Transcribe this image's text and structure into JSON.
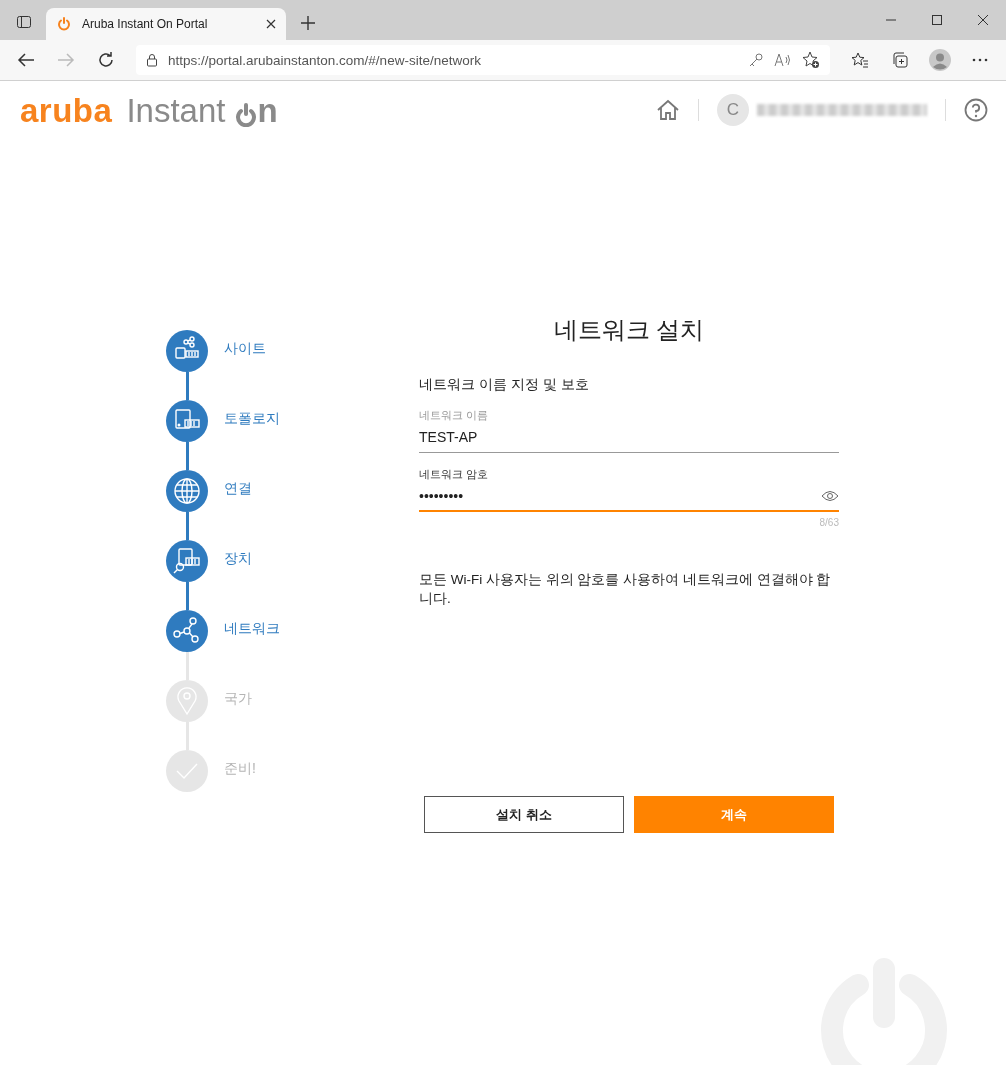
{
  "browser": {
    "tab_title": "Aruba Instant On Portal",
    "url": "https://portal.arubainstanton.com/#/new-site/network"
  },
  "header": {
    "logo_brand": "aruba",
    "logo_product": "Instant",
    "logo_suffix": "n",
    "avatar_initial": "C"
  },
  "steps": [
    {
      "label": "사이트",
      "kind": "site",
      "done": true
    },
    {
      "label": "토폴로지",
      "kind": "topology",
      "done": true
    },
    {
      "label": "연결",
      "kind": "globe",
      "done": true
    },
    {
      "label": "장치",
      "kind": "device",
      "done": true
    },
    {
      "label": "네트워크",
      "kind": "network",
      "done": true
    },
    {
      "label": "국가",
      "kind": "location",
      "done": false
    },
    {
      "label": "준비!",
      "kind": "check",
      "done": false
    }
  ],
  "form": {
    "title": "네트워크 설치",
    "subtitle": "네트워크 이름 지정 및 보호",
    "fields": [
      {
        "kind": "text",
        "label": "네트워크 이름",
        "value": "TEST-AP",
        "focused": false
      },
      {
        "kind": "password",
        "label": "네트워크 암호",
        "value": "•••••••••",
        "focused": true,
        "counter": "8/63"
      }
    ],
    "note": "모든 Wi-Fi 사용자는 위의 암호를 사용하여 네트워크에 연결해야 합니다.",
    "buttons": [
      {
        "label": "설치 취소",
        "kind": "secondary"
      },
      {
        "label": "계속",
        "kind": "primary"
      }
    ]
  }
}
